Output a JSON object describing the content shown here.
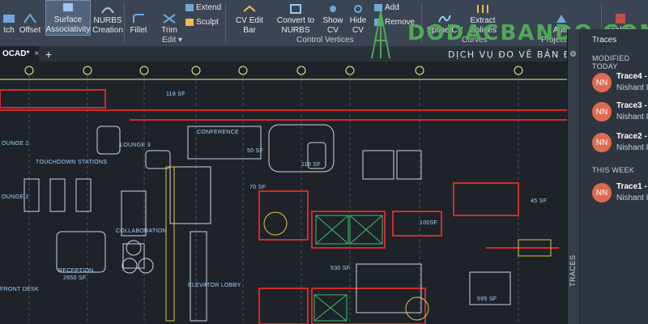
{
  "ribbon": {
    "buttons": [
      {
        "id": "patch",
        "label": "tch"
      },
      {
        "id": "offset",
        "label": "Offset"
      },
      {
        "id": "surface_associativity",
        "label": "Surface\nAssociativity"
      },
      {
        "id": "nurbs_creation",
        "label": "NURBS\nCreation"
      },
      {
        "id": "fillet",
        "label": "Fillet"
      },
      {
        "id": "trim",
        "label": "Trim"
      },
      {
        "id": "cv_edit_bar",
        "label": "CV Edit Bar"
      },
      {
        "id": "convert_to_nurbs",
        "label": "Convert to\nNURBS"
      },
      {
        "id": "show_cv",
        "label": "Show\nCV"
      },
      {
        "id": "hide_cv",
        "label": "Hide\nCV"
      },
      {
        "id": "spline_cv",
        "label": "Spline CV"
      },
      {
        "id": "extract_isolines",
        "label": "Extract\nIsolines"
      },
      {
        "id": "auto",
        "label": "Auto"
      },
      {
        "id": "analysis",
        "label": "Analysis"
      }
    ],
    "small": {
      "extend": "Extend",
      "sculpt": "Sculpt",
      "add": "Add",
      "remove": "Remove"
    },
    "panels": {
      "edit": "Edit ▾",
      "control_vertices": "Control Vertices",
      "curves": "Curves",
      "project": "Project"
    }
  },
  "tabs": {
    "document": "OCAD*",
    "close": "×",
    "new": "+"
  },
  "drawing": {
    "labels": [
      "118 SF",
      "OUNGE 2",
      "LOUNGE 3",
      "CONFERENCE",
      "50 SF",
      "118 SF",
      "TOUCHDOWN STATIONS",
      "OUNGE 1",
      "COLLABORATION",
      "RECEPTION",
      "2650 SF",
      "FRONT DESK",
      "ELEVATOR LOBBY",
      "70 SF",
      "530 SF",
      "100SF",
      "595 SF",
      "45 SF"
    ]
  },
  "watermark": {
    "title": "DODACBANDO.COM",
    "subtitle": "DỊCH VỤ ĐO VẼ BẢN ĐỒ TP.HCM"
  },
  "traces": {
    "title": "Traces",
    "tab_label": "TRACES",
    "sections": {
      "modified_today": "MODIFIED TODAY",
      "this_week": "THIS WEEK"
    },
    "items": [
      {
        "name": "Trace4 - (",
        "user": "Nishant I",
        "avatar": "NN"
      },
      {
        "name": "Trace3 - /",
        "user": "Nishant I",
        "avatar": "NN"
      },
      {
        "name": "Trace2 - I",
        "user": "Nishant I",
        "avatar": "NN"
      },
      {
        "name": "Trace1 - I",
        "user": "Nishant I",
        "avatar": "NN"
      }
    ]
  },
  "colors": {
    "ribbon_bg": "#3b4453",
    "canvas_bg": "#1e2329",
    "wall_red": "#d22b2b",
    "accent_yellow": "#f3f08a",
    "avatar": "#e0694f",
    "watermark_green": "#4faa54"
  }
}
